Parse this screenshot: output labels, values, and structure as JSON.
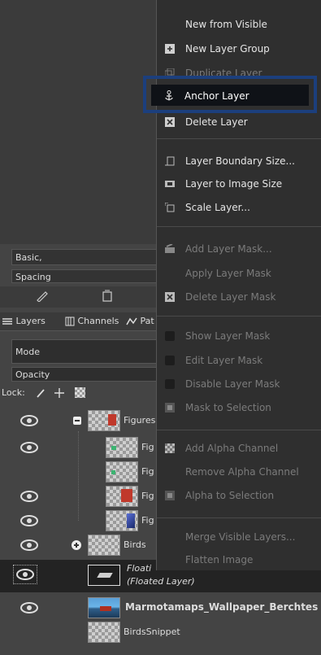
{
  "brush": {
    "preset": "Basic,",
    "spacing_label": "Spacing"
  },
  "tabs": [
    {
      "label": "Layers"
    },
    {
      "label": "Channels"
    },
    {
      "label": "Pat"
    }
  ],
  "layers_panel": {
    "mode_label": "Mode",
    "opacity_label": "Opacity",
    "lock_label": "Lock:"
  },
  "layers": [
    {
      "name": "Figures"
    },
    {
      "name": "Fig"
    },
    {
      "name": "Fig"
    },
    {
      "name": "Fig"
    },
    {
      "name": "Fig"
    },
    {
      "name": "Birds"
    },
    {
      "name": "Floati",
      "sub": "(Floated Layer)"
    },
    {
      "name": "Marmotamaps_Wallpaper_Berchtes"
    },
    {
      "name": "BirdsSnippet"
    }
  ],
  "menu": {
    "new_from_visible": "New from Visible",
    "new_layer_group": "New Layer Group",
    "duplicate_layer": "Duplicate Layer",
    "anchor_layer": "Anchor Layer",
    "delete_layer": "Delete Layer",
    "layer_boundary_size": "Layer Boundary Size...",
    "layer_to_image_size": "Layer to Image Size",
    "scale_layer": "Scale Layer...",
    "add_layer_mask": "Add Layer Mask...",
    "apply_layer_mask": "Apply Layer Mask",
    "delete_layer_mask": "Delete Layer Mask",
    "show_layer_mask": "Show Layer Mask",
    "edit_layer_mask": "Edit Layer Mask",
    "disable_layer_mask": "Disable Layer Mask",
    "mask_to_selection": "Mask to Selection",
    "add_alpha_channel": "Add Alpha Channel",
    "remove_alpha_channel": "Remove Alpha Channel",
    "alpha_to_selection": "Alpha to Selection",
    "merge_visible_layers": "Merge Visible Layers...",
    "flatten_image": "Flatten Image"
  }
}
